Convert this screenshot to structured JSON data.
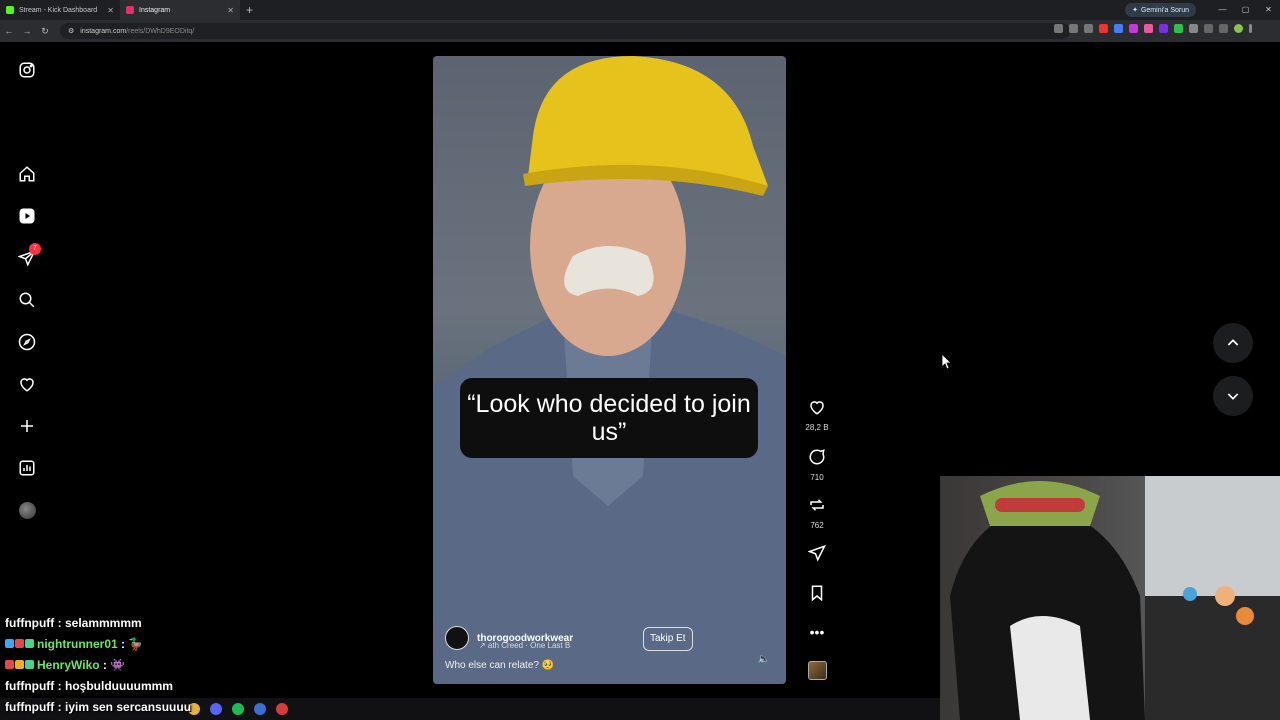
{
  "browser": {
    "tabs": [
      {
        "title": "Stream - Kick Dashboard",
        "color": "#53fc18"
      },
      {
        "title": "Instagram",
        "color": "#e1306c"
      }
    ],
    "url_host": "instagram.com",
    "url_path": "/reels/DWhD9EODitq/",
    "gemini_label": "Gemini'a Sorun"
  },
  "sidebar": {
    "notifications_badge": "7",
    "items": [
      "instagram-logo",
      "home",
      "reels",
      "messages",
      "search",
      "explore",
      "notifications",
      "create",
      "dashboard",
      "profile"
    ]
  },
  "reel": {
    "overlay_text": "“Look who decided to join us”",
    "owner": "thorogoodworkwear",
    "music": "↗ ath          Creed · One Last B",
    "follow_label": "Takip Et",
    "caption": "Who else can relate? 🥺",
    "likes": "28,2 B",
    "comments": "710",
    "reposts": "762"
  },
  "chat": [
    {
      "user": "fuffnpuff",
      "user_color": "#ffffff",
      "message": "selammmmm",
      "badges": []
    },
    {
      "user": "nightrunner01",
      "user_color": "#6fe36b",
      "message": "🦆",
      "badges": [
        "#3aa7ff",
        "#e54848",
        "#4ad38a"
      ]
    },
    {
      "user": "HenryWiko",
      "user_color": "#6fe36b",
      "message": "👾",
      "badges": [
        "#e54848",
        "#f0b020",
        "#4ad38a"
      ]
    },
    {
      "user": "fuffnpuff",
      "user_color": "#ffffff",
      "message": "hoşbulduuuummm",
      "badges": []
    },
    {
      "user": "fuffnpuff",
      "user_color": "#ffffff",
      "message": "iyim sen sercansuuuu",
      "badges": []
    }
  ]
}
